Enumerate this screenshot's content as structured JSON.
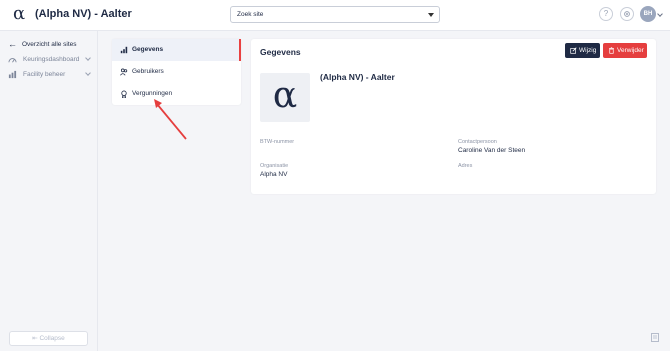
{
  "header": {
    "logo_glyph": "α",
    "site_title": "(Alpha NV) - Aalter",
    "site_search_placeholder": "Zoek site",
    "help_glyph": "?",
    "avatar_initials": "BH"
  },
  "sidebar": {
    "back_label": "Overzicht alle sites",
    "back_glyph": "←",
    "items": [
      {
        "label": "Keuringsdashboard",
        "icon": "dashboard-icon"
      },
      {
        "label": "Facility beheer",
        "icon": "building-icon"
      }
    ],
    "collapse_label": "Collapse"
  },
  "subnav": {
    "items": [
      {
        "label": "Gegevens",
        "icon": "chart-icon",
        "active": true
      },
      {
        "label": "Gebruikers",
        "icon": "users-icon",
        "active": false
      },
      {
        "label": "Vergunningen",
        "icon": "award-icon",
        "active": false
      }
    ]
  },
  "card": {
    "title": "Gegevens",
    "edit_label": "Wijzig",
    "delete_label": "Verwijder",
    "logo_glyph": "α",
    "org_display_name": "(Alpha NV) - Aalter",
    "fields": {
      "btw_label": "BTW-nummer",
      "btw_value": "",
      "contact_label": "Contactpersoon",
      "contact_value": "Caroline Van der Steen",
      "org_label": "Organisatie",
      "org_value": "Alpha NV",
      "address_label": "Adres",
      "address_value": ""
    }
  },
  "colors": {
    "primary": "#1f2a44",
    "danger": "#e53e3e",
    "annotation": "#e53e3e",
    "active_indicator": "#e94141"
  }
}
